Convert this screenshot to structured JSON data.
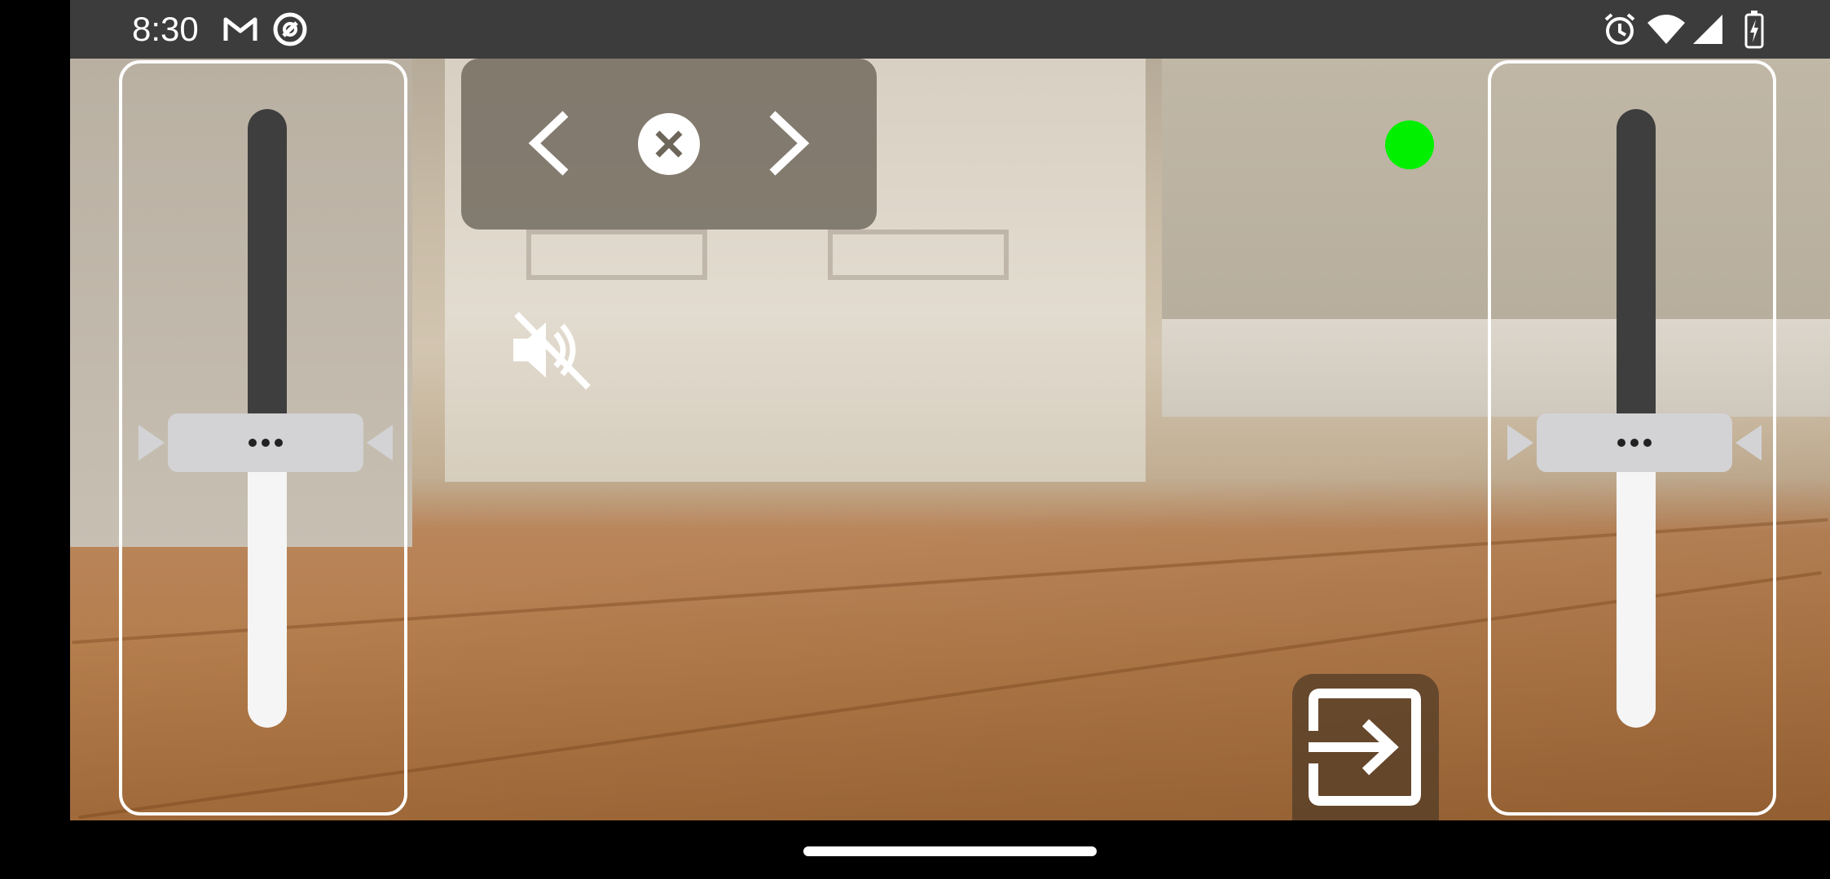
{
  "status_bar": {
    "time": "8:30",
    "left_icons": [
      "gmail-icon",
      "app-notification-icon"
    ],
    "right_icons": [
      "alarm-icon",
      "wifi-icon",
      "cellular-signal-icon",
      "battery-charging-icon"
    ]
  },
  "camera_view": {
    "connection_status_color": "#00f000"
  },
  "left_slider": {
    "handle_icon": "more-horizontal-icon",
    "level": 0.5
  },
  "right_slider": {
    "handle_icon": "more-horizontal-icon",
    "level": 0.5
  },
  "nav_panel": {
    "buttons": [
      "chevron-left-icon",
      "close-circle-icon",
      "chevron-right-icon"
    ]
  },
  "audio": {
    "icon": "volume-off-icon",
    "muted": true
  },
  "exit": {
    "icon": "exit-to-app-icon"
  },
  "colors": {
    "status_bar_bg": "#3c3c3c",
    "nav_panel_bg": "#6e665a",
    "slider_track_dark": "#3e3e3e",
    "slider_track_light": "#f5f5f5",
    "slider_thumb": "#d3d3d6"
  }
}
